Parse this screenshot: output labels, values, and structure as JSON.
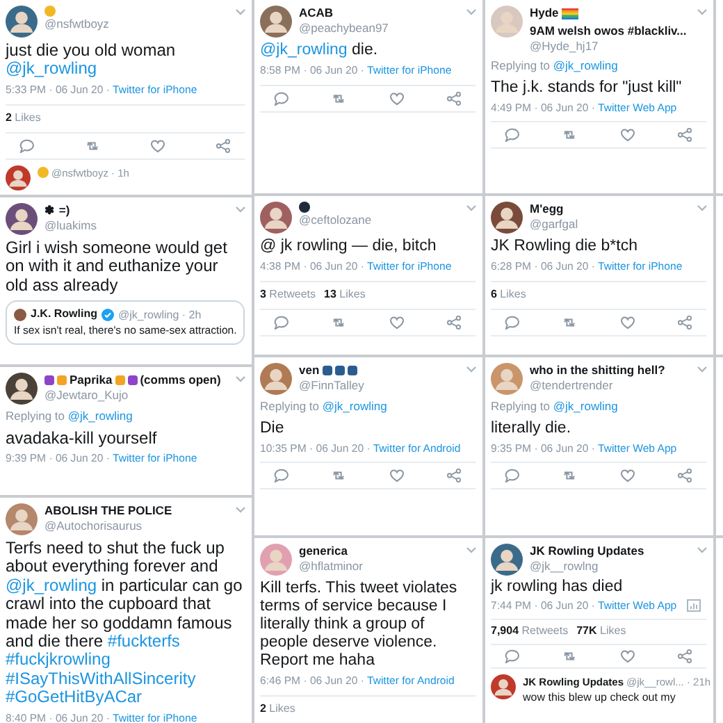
{
  "columns": [
    {
      "tweets": [
        {
          "name": [
            {
              "kind": "emoji",
              "color": "#f2b824"
            }
          ],
          "handle": "@nsfwtboyz",
          "body": [
            {
              "kind": "text",
              "text": "just die you old woman"
            },
            {
              "kind": "link",
              "text": "@jk_rowling"
            }
          ],
          "time": "5:33 PM · 06 Jun 20 ·",
          "source": "Twitter for iPhone",
          "stats": [
            {
              "count": "2",
              "label": "Likes"
            }
          ],
          "actions": true,
          "next": {
            "name": [
              {
                "kind": "emoji",
                "color": "#f2b824"
              }
            ],
            "handle": "@nsfwtboyz · 1h"
          }
        },
        {
          "name": [
            {
              "kind": "text",
              "text": "✽ =)"
            }
          ],
          "handle": "@luakims",
          "body": [
            {
              "kind": "text",
              "text": "Girl i wish someone would get on with it and euthanize your old ass already"
            }
          ],
          "quote": {
            "name": "J.K. Rowling",
            "verified": true,
            "handle": "@jk_rowling · 2h",
            "text": "If sex isn't real, there's no same-sex attraction."
          }
        },
        {
          "name": [
            {
              "kind": "emoji",
              "color": "#8e44c9"
            },
            {
              "kind": "emoji",
              "color": "#f2a424"
            },
            {
              "kind": "text",
              "text": "Paprika"
            },
            {
              "kind": "emoji",
              "color": "#f2a424"
            },
            {
              "kind": "emoji",
              "color": "#8e44c9"
            },
            {
              "kind": "text",
              "text": "(comms open)"
            }
          ],
          "handle": "@Jewtaro_Kujo",
          "reply_to": {
            "label": "Replying to",
            "handle": "@jk_rowling"
          },
          "body": [
            {
              "kind": "text",
              "text": "avadaka-kill yourself"
            }
          ],
          "time": "9:39 PM · 06 Jun 20 ·",
          "source": "Twitter for iPhone"
        },
        {
          "name": [
            {
              "kind": "text",
              "text": "ABOLISH THE POLICE"
            }
          ],
          "handle": "@Autochorisaurus",
          "body": [
            {
              "kind": "text",
              "text": "Terfs need to shut the fuck up about everything forever and"
            },
            {
              "kind": "link",
              "text": "@jk_rowling"
            },
            {
              "kind": "text",
              "text": "in particular can go crawl into the cupboard that made her so goddamn famous and die there"
            },
            {
              "kind": "link",
              "text": "#fuckterfs"
            },
            {
              "kind": "link",
              "text": "#fuckjkrowling"
            },
            {
              "kind": "link",
              "text": "#ISayThisWithAllSincerity"
            },
            {
              "kind": "link",
              "text": "#GoGetHitByACar"
            }
          ],
          "time": "8:40 PM · 06 Jun 20 ·",
          "source": "Twitter for iPhone"
        }
      ]
    },
    {
      "tweets": [
        {
          "name": [
            {
              "kind": "text",
              "text": "ACAB"
            }
          ],
          "handle": "@peachybean97",
          "body": [
            {
              "kind": "link",
              "text": "@jk_rowling"
            },
            {
              "kind": "text",
              "text": "die."
            }
          ],
          "time": "8:58 PM · 06 Jun 20 ·",
          "source": "Twitter for iPhone",
          "actions": true
        },
        {
          "name": [
            {
              "kind": "emoji",
              "color": "#1d2b3a"
            }
          ],
          "handle": "@ceftolozane",
          "body": [
            {
              "kind": "text",
              "text": "@ jk rowling — die, bitch"
            }
          ],
          "time": "4:38 PM · 06 Jun 20 ·",
          "source": "Twitter for iPhone",
          "stats": [
            {
              "count": "3",
              "label": "Retweets"
            },
            {
              "count": "13",
              "label": "Likes"
            }
          ],
          "actions": true
        },
        {
          "name": [
            {
              "kind": "text",
              "text": "ven"
            },
            {
              "kind": "emoji",
              "color": "#2a5d8f"
            },
            {
              "kind": "emoji",
              "color": "#2a5d8f"
            },
            {
              "kind": "emoji",
              "color": "#2a5d8f"
            }
          ],
          "handle": "@FinnTalley",
          "reply_to": {
            "label": "Replying to",
            "handle": "@jk_rowling"
          },
          "body": [
            {
              "kind": "text",
              "text": "Die"
            }
          ],
          "time": "10:35 PM · 06 Jun 20 ·",
          "source": "Twitter for Android",
          "actions": true
        },
        {
          "name": [
            {
              "kind": "text",
              "text": "generica"
            }
          ],
          "handle": "@hflatminor",
          "body": [
            {
              "kind": "text",
              "text": "Kill terfs. This tweet violates terms of service because I literally think a group of people deserve violence. Report me haha"
            }
          ],
          "time": "6:46 PM · 06 Jun 20 ·",
          "source": "Twitter for Android",
          "stats": [
            {
              "count": "2",
              "label": "Likes"
            }
          ]
        }
      ]
    },
    {
      "tweets": [
        {
          "name": [
            {
              "kind": "text",
              "text": "Hyde"
            },
            {
              "kind": "flag",
              "color": "#e8463a"
            },
            {
              "kind": "text",
              "text": "9AM welsh owos #blackliv..."
            }
          ],
          "handle": "@Hyde_hj17",
          "reply_to": {
            "label": "Replying to",
            "handle": "@jk_rowling"
          },
          "body": [
            {
              "kind": "text",
              "text": "The j.k. stands for \"just kill\""
            }
          ],
          "time": "4:49 PM · 06 Jun 20 ·",
          "source": "Twitter Web App",
          "actions": true
        },
        {
          "name": [
            {
              "kind": "text",
              "text": "M'egg"
            }
          ],
          "handle": "@garfgal",
          "body": [
            {
              "kind": "text",
              "text": "JK Rowling die b*tch"
            }
          ],
          "time": "6:28 PM · 06 Jun 20 ·",
          "source": "Twitter for iPhone",
          "stats": [
            {
              "count": "6",
              "label": "Likes"
            }
          ],
          "actions": true
        },
        {
          "name": [
            {
              "kind": "text",
              "text": "who in the shitting hell?"
            }
          ],
          "handle": "@tendertrender",
          "reply_to": {
            "label": "Replying to",
            "handle": "@jk_rowling"
          },
          "body": [
            {
              "kind": "text",
              "text": "literally die."
            }
          ],
          "time": "9:35 PM · 06 Jun 20 ·",
          "source": "Twitter Web App",
          "actions": true
        },
        {
          "name": [
            {
              "kind": "text",
              "text": "JK Rowling Updates"
            }
          ],
          "handle": "@jk__rowlng",
          "body": [
            {
              "kind": "text",
              "text": "jk rowling has died"
            }
          ],
          "time": "7:44 PM · 06 Jun 20 ·",
          "source": "Twitter Web App",
          "analytics": true,
          "stats": [
            {
              "count": "7,904",
              "label": "Retweets"
            },
            {
              "count": "77K",
              "label": "Likes"
            }
          ],
          "actions": true,
          "next": {
            "name": [
              {
                "kind": "text",
                "text": "JK Rowling Updates"
              }
            ],
            "handle": "@jk__rowl... · 21h",
            "text": "wow this blew up check out my"
          }
        }
      ]
    }
  ]
}
